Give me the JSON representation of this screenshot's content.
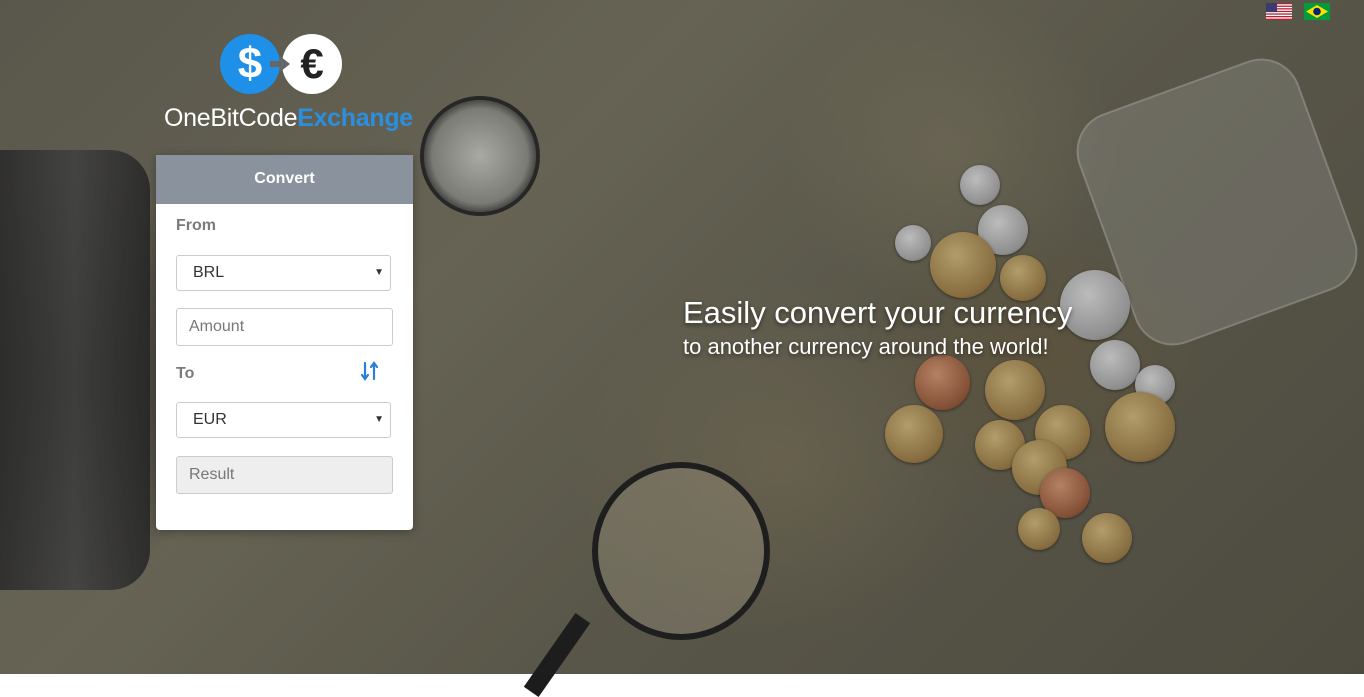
{
  "languages": [
    {
      "icon": "us-flag-icon"
    },
    {
      "icon": "brazil-flag-icon"
    }
  ],
  "logo": {
    "name_prefix": "OneBitCode",
    "name_suffix": "Exchange",
    "symbol_left": "$",
    "symbol_right": "€",
    "accent_color": "#1e90e8"
  },
  "converter": {
    "header": "Convert",
    "from_label": "From",
    "from_currency": "BRL",
    "amount_placeholder": "Amount",
    "amount_value": "",
    "to_label": "To",
    "to_currency": "EUR",
    "result_placeholder": "Result",
    "result_value": "",
    "swap_icon": "swap-vertical-icon",
    "header_color": "#8a929e"
  },
  "hero": {
    "title": "Easily convert your currency",
    "subtitle": "to another currency around the world!"
  }
}
